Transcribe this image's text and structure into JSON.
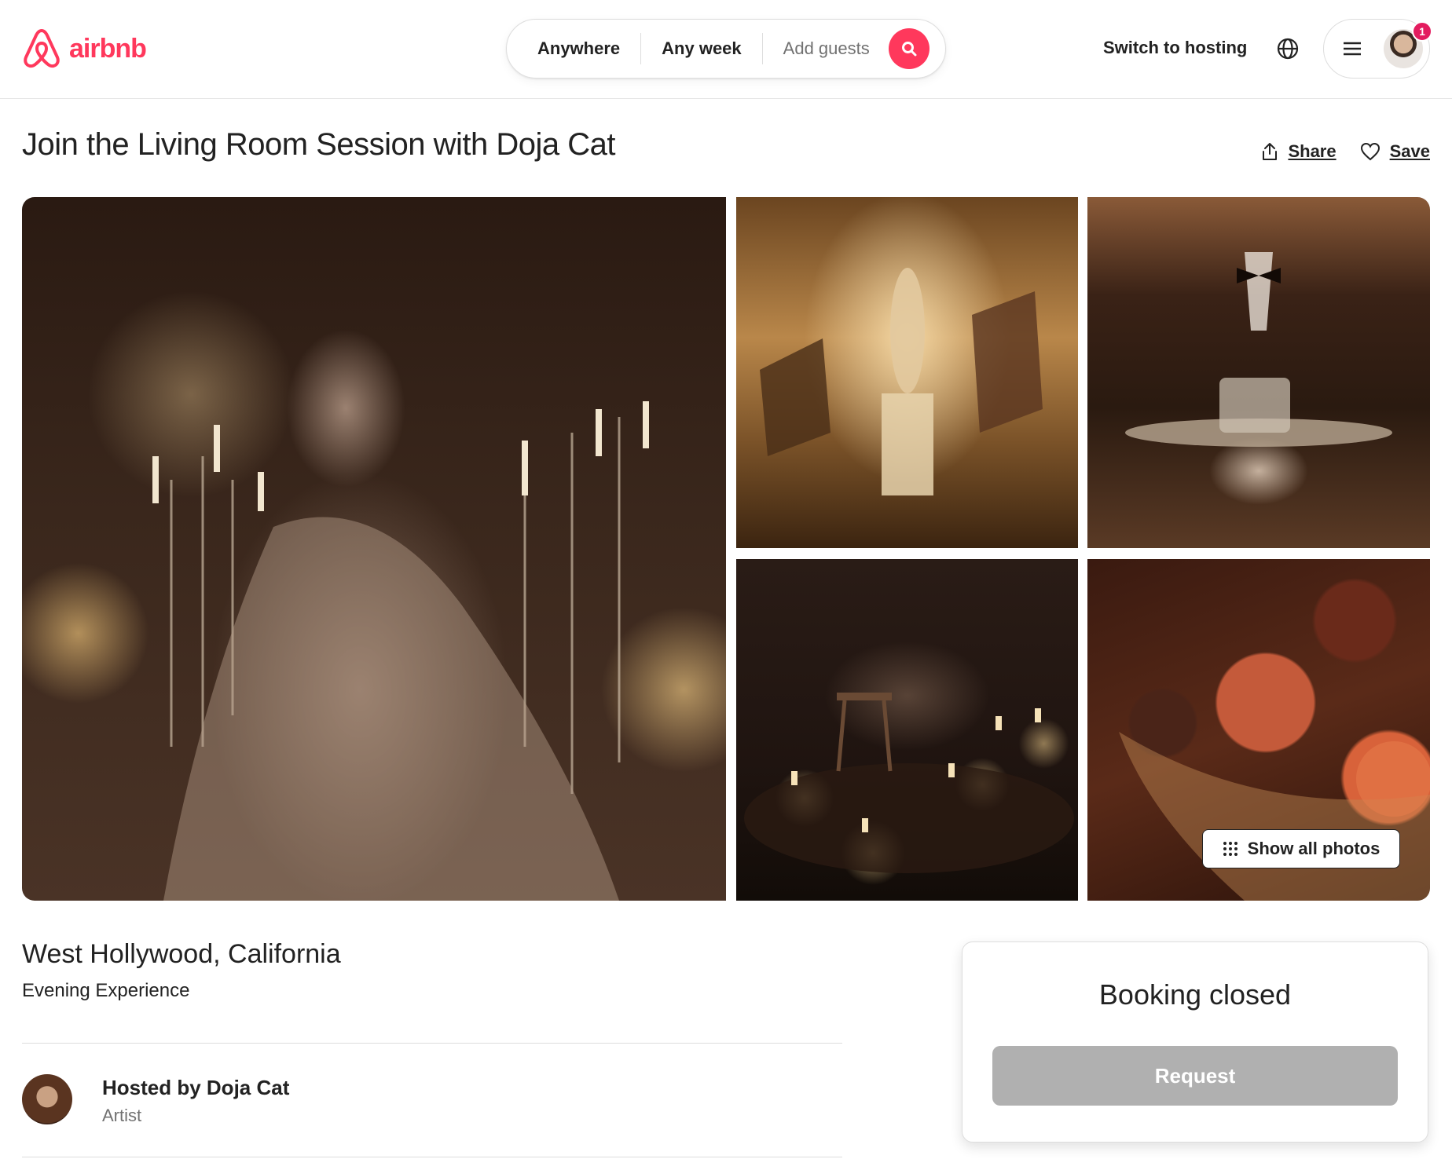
{
  "header": {
    "logo_text": "airbnb",
    "search": {
      "location": "Anywhere",
      "dates": "Any week",
      "guests_placeholder": "Add guests"
    },
    "switch_hosting": "Switch to hosting",
    "notification_count": "1"
  },
  "listing": {
    "title": "Join the Living Room Session with Doja Cat",
    "share_label": "Share",
    "save_label": "Save",
    "show_all_photos": "Show all photos",
    "location": "West Hollywood, California",
    "subtitle": "Evening Experience",
    "host": {
      "name": "Hosted by Doja Cat",
      "role": "Artist"
    }
  },
  "booking": {
    "status": "Booking closed",
    "request_label": "Request"
  },
  "colors": {
    "brand": "#ff385c",
    "badge": "#e31c5f",
    "disabled_button": "#b0b0b0"
  }
}
